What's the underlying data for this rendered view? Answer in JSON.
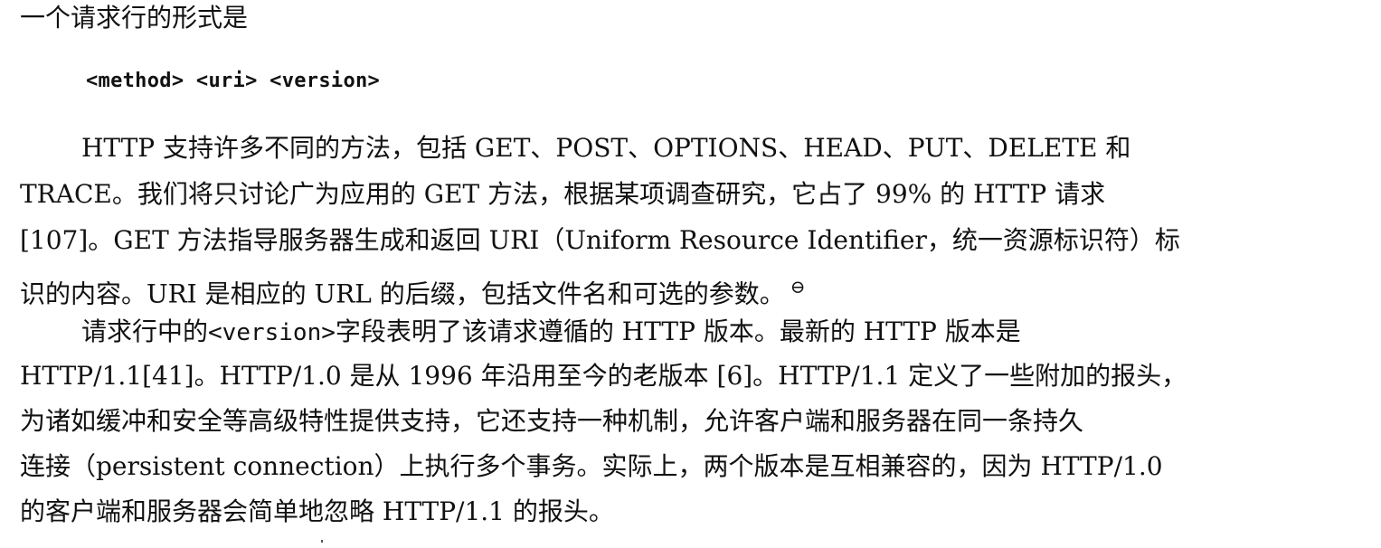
{
  "heading": "一个请求行的形式是",
  "code_line": "<method> <uri> <version>",
  "para1": {
    "lines": [
      "HTTP 支持许多不同的方法，包括 GET、POST、OPTIONS、HEAD、PUT、DELETE 和",
      "TRACE。我们将只讨论广为应用的 GET 方法，根据某项调查研究，它占了 99% 的 HTTP 请求",
      "[107]。GET 方法指导服务器生成和返回 URI（Uniform Resource Identifier，统一资源标识符）标",
      "识的内容。URI 是相应的 URL 的后缀，包括文件名和可选的参数。"
    ],
    "footnote_mark": "⊖"
  },
  "para2": {
    "line1_prefix": "请求行中的",
    "line1_code": "<version>",
    "line1_suffix": "字段表明了该请求遵循的 HTTP 版本。最新的 HTTP 版本是",
    "lines": [
      "HTTP/1.1[41]。HTTP/1.0 是从 1996 年沿用至今的老版本 [6]。HTTP/1.1 定义了一些附加的报头，",
      "为诸如缓冲和安全等高级特性提供支持，它还支持一种机制，允许客户端和服务器在同一条持久",
      "连接（persistent connection）上执行多个事务。实际上，两个版本是互相兼容的，因为 HTTP/1.0",
      "的客户端和服务器会简单地忽略 HTTP/1.1 的报头。"
    ]
  }
}
